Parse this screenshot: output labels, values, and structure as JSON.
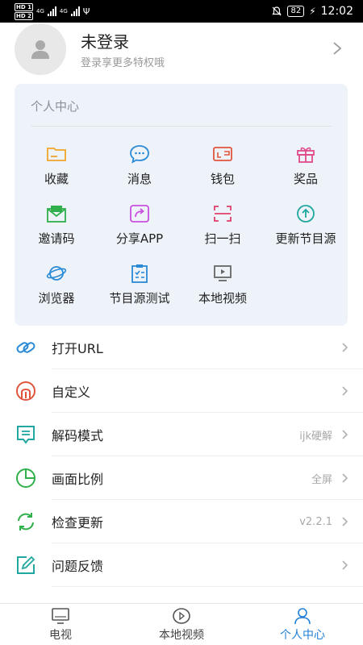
{
  "status_bar": {
    "sim1": "HD 1",
    "sim2": "HD 2",
    "net1": "4G",
    "net2": "4G",
    "usb": "Ψ",
    "battery": "82",
    "time": "12:02"
  },
  "profile": {
    "name": "未登录",
    "subtitle": "登录享更多特权哦"
  },
  "personal_center": {
    "title": "个人中心",
    "items": [
      {
        "label": "收藏",
        "icon": "folder-icon",
        "color": "#f0a52a"
      },
      {
        "label": "消息",
        "icon": "message-icon",
        "color": "#2a8ad6"
      },
      {
        "label": "钱包",
        "icon": "wallet-icon",
        "color": "#e0553c"
      },
      {
        "label": "奖品",
        "icon": "gift-icon",
        "color": "#e04a8a"
      },
      {
        "label": "邀请码",
        "icon": "invite-mail-icon",
        "color": "#2fb04a"
      },
      {
        "label": "分享APP",
        "icon": "share-icon",
        "color": "#c94fe0"
      },
      {
        "label": "扫一扫",
        "icon": "scan-icon",
        "color": "#e0406a"
      },
      {
        "label": "更新节目源",
        "icon": "upload-cloud-icon",
        "color": "#20a8a0"
      },
      {
        "label": "浏览器",
        "icon": "planet-icon",
        "color": "#2a8ad6"
      },
      {
        "label": "节目源测试",
        "icon": "clipboard-test-icon",
        "color": "#2a8ad6"
      },
      {
        "label": "本地视频",
        "icon": "video-player-icon",
        "color": "#666666"
      }
    ]
  },
  "settings": [
    {
      "label": "打开URL",
      "value": "",
      "icon": "link-icon",
      "color": "#2a8ad6"
    },
    {
      "label": "自定义",
      "value": "",
      "icon": "custom-icon",
      "color": "#e0553c"
    },
    {
      "label": "解码模式",
      "value": "ijk硬解",
      "icon": "decode-icon",
      "color": "#20a8a0"
    },
    {
      "label": "画面比例",
      "value": "全屏",
      "icon": "ratio-pie-icon",
      "color": "#2fb04a"
    },
    {
      "label": "检查更新",
      "value": "v2.2.1",
      "icon": "refresh-icon",
      "color": "#2fb04a"
    },
    {
      "label": "问题反馈",
      "value": "",
      "icon": "feedback-icon",
      "color": "#20a8a0"
    }
  ],
  "bottom_nav": [
    {
      "label": "电视",
      "icon": "tv-icon",
      "active": false
    },
    {
      "label": "本地视频",
      "icon": "play-circle-icon",
      "active": false
    },
    {
      "label": "个人中心",
      "icon": "user-icon",
      "active": true
    }
  ],
  "colors": {
    "accent": "#1e7fd6",
    "card_bg": "#eef3f9"
  }
}
